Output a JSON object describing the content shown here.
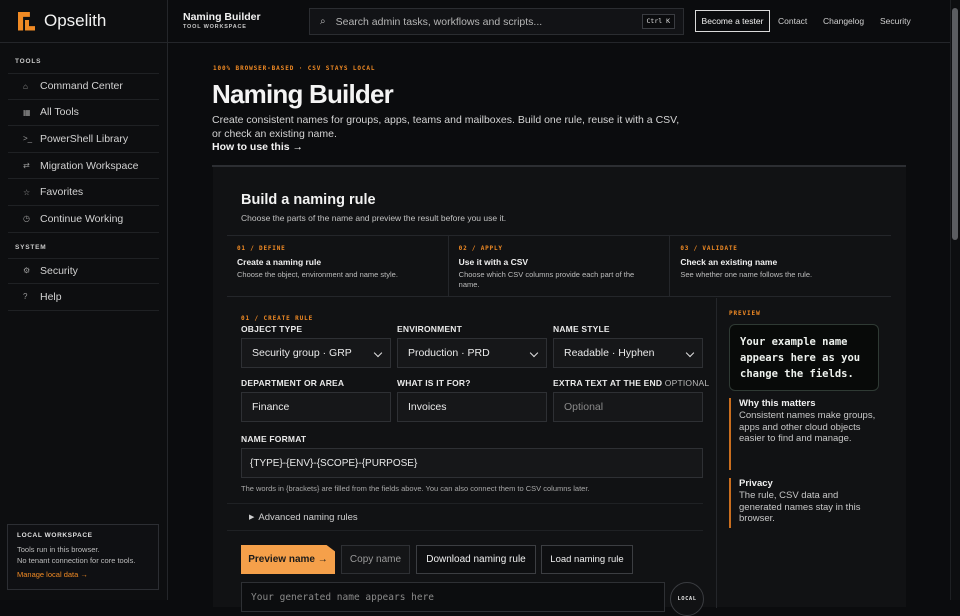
{
  "brand": {
    "name": "Opselith"
  },
  "sidebar": {
    "tools_heading": "TOOLS",
    "tools": [
      {
        "icon": "⌂",
        "label": "Command Center"
      },
      {
        "icon": "▦",
        "label": "All Tools"
      },
      {
        "icon": ">_",
        "label": "PowerShell Library"
      },
      {
        "icon": "⇄",
        "label": "Migration Workspace"
      },
      {
        "icon": "☆",
        "label": "Favorites"
      },
      {
        "icon": "◷",
        "label": "Continue Working"
      }
    ],
    "system_heading": "SYSTEM",
    "system": [
      {
        "icon": "⚙",
        "label": "Security"
      },
      {
        "icon": "?",
        "label": "Help"
      }
    ],
    "local_box": {
      "title": "LOCAL WORKSPACE",
      "line1": "Tools run in this browser.",
      "line2": "No tenant connection for core tools.",
      "link": "Manage local data →"
    }
  },
  "topbar": {
    "title": "Naming Builder",
    "subtitle": "TOOL WORKSPACE",
    "search_placeholder": "Search admin tasks, workflows and scripts...",
    "shortcut": "Ctrl K",
    "cta": "Become a tester",
    "links": [
      "Contact",
      "Changelog",
      "Security"
    ]
  },
  "hero": {
    "eyebrow": "100% BROWSER-BASED · CSV STAYS LOCAL",
    "title": "Naming Builder",
    "description": "Create consistent names for groups, apps, teams and mailboxes. Build one rule, reuse it with a CSV, or check an existing name.",
    "howto": "How to use this →"
  },
  "panel": {
    "title": "Build a naming rule",
    "subtitle": "Choose the parts of the name and preview the result before you use it.",
    "steps": [
      {
        "num": "01 / DEFINE",
        "title": "Create a naming rule",
        "desc": "Choose the object, environment and name style."
      },
      {
        "num": "02 / APPLY",
        "title": "Use it with a CSV",
        "desc": "Choose which CSV columns provide each part of the name."
      },
      {
        "num": "03 / VALIDATE",
        "title": "Check an existing name",
        "desc": "See whether one name follows the rule."
      }
    ],
    "section_label": "01 / CREATE RULE",
    "fields": {
      "object_type_label": "OBJECT TYPE",
      "object_type_value": "Security group · GRP",
      "environment_label": "ENVIRONMENT",
      "environment_value": "Production · PRD",
      "style_label": "NAME STYLE",
      "style_value": "Readable · Hyphen",
      "department_label": "DEPARTMENT OR AREA",
      "department_value": "Finance",
      "purpose_label": "WHAT IS IT FOR?",
      "purpose_value": "Invoices",
      "extra_label": "EXTRA TEXT AT THE END",
      "extra_optional": "OPTIONAL",
      "extra_placeholder": "Optional",
      "format_label": "NAME FORMAT",
      "format_value": "{TYPE}-{ENV}-{SCOPE}-{PURPOSE}"
    },
    "hint": "The words in {brackets} are filled from the fields above. You can also connect them to CSV columns later.",
    "advanced": "Advanced naming rules",
    "buttons": {
      "preview": "Preview name →",
      "copy": "Copy name",
      "download": "Download naming rule",
      "load": "Load naming rule"
    },
    "output_placeholder": "Your generated name appears here",
    "local_pill": "LOCAL"
  },
  "preview": {
    "label": "PREVIEW",
    "text": "Your example name appears here as you change the fields.",
    "why_title": "Why this matters",
    "why_body": "Consistent names make groups, apps and other cloud objects easier to find and manage.",
    "privacy_title": "Privacy",
    "privacy_body": "The rule, CSV data and generated names stay in this browser."
  },
  "colors": {
    "accent": "#f08a24",
    "background": "#0b0c0e",
    "panel": "#111214"
  }
}
